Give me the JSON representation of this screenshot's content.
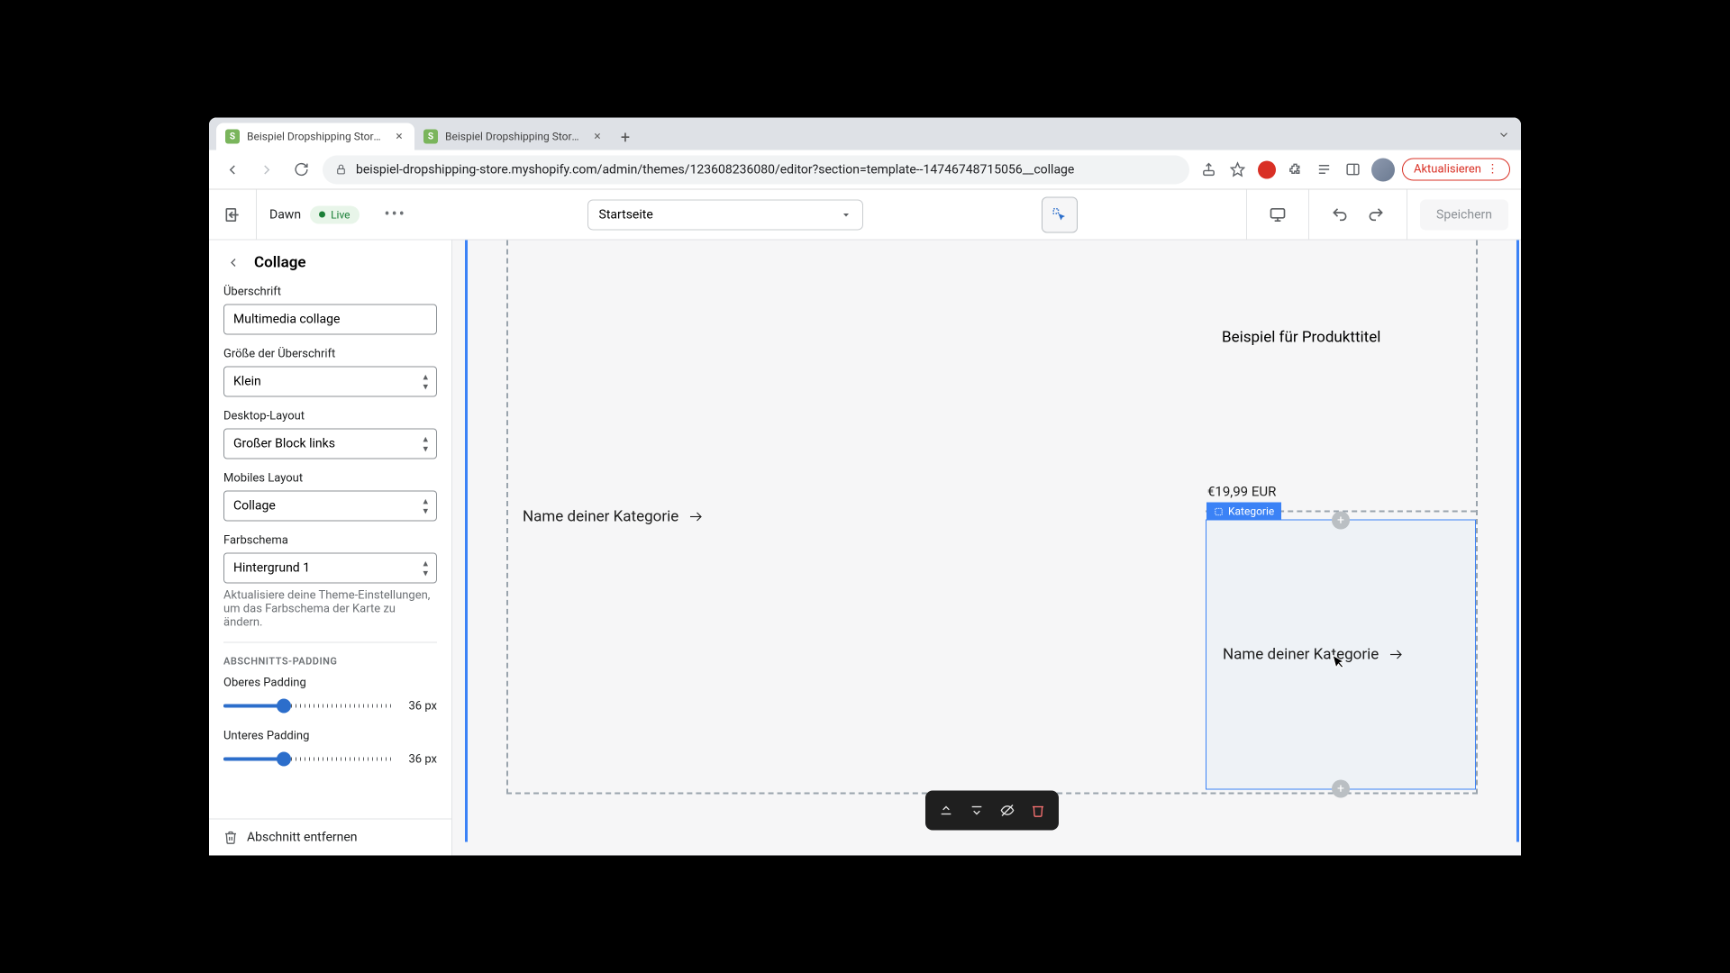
{
  "browser": {
    "tabs": [
      {
        "title": "Beispiel Dropshipping Store · D"
      },
      {
        "title": "Beispiel Dropshipping Store · E"
      }
    ],
    "url": "beispiel-dropshipping-store.myshopify.com/admin/themes/123608236080/editor?section=template--14746748715056__collage",
    "update_button": "Aktualisieren"
  },
  "editor": {
    "theme_name": "Dawn",
    "live_badge": "Live",
    "page_selected": "Startseite",
    "save_button": "Speichern"
  },
  "sidebar": {
    "section_title": "Collage",
    "fields": {
      "heading_label": "Überschrift",
      "heading_value": "Multimedia collage",
      "heading_size_label": "Größe der Überschrift",
      "heading_size_value": "Klein",
      "desktop_layout_label": "Desktop-Layout",
      "desktop_layout_value": "Großer Block links",
      "mobile_layout_label": "Mobiles Layout",
      "mobile_layout_value": "Collage",
      "color_scheme_label": "Farbschema",
      "color_scheme_value": "Hintergrund 1",
      "color_scheme_help": "Aktualisiere deine Theme-Einstellungen, um das Farbschema der Karte zu ändern."
    },
    "padding": {
      "group_label": "ABSCHNITTS-PADDING",
      "top_label": "Oberes Padding",
      "top_value": "36 px",
      "top_percent": 36,
      "bottom_label": "Unteres Padding",
      "bottom_value": "36 px",
      "bottom_percent": 36
    },
    "remove_section": "Abschnitt entfernen"
  },
  "preview": {
    "big_category_text": "Name deiner Kategorie",
    "product_title": "Beispiel für Produkttitel",
    "product_price": "€19,99 EUR",
    "category_tag": "Kategorie",
    "small_category_text": "Name deiner Kategorie"
  }
}
